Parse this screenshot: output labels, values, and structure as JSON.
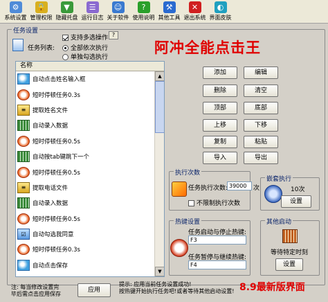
{
  "toolbar": {
    "items": [
      {
        "label": "系统设置",
        "icon": "gear-icon",
        "color": "#4f8bd8",
        "glyph": "⚙"
      },
      {
        "label": "管理权限",
        "icon": "lock-icon",
        "color": "#d8b020",
        "glyph": "🔒"
      },
      {
        "label": "隐藏托盘",
        "icon": "hide-tray-icon",
        "color": "#3a9a3a",
        "glyph": "▼"
      },
      {
        "label": "运行日志",
        "icon": "log-icon",
        "color": "#8a6ad0",
        "glyph": "☰"
      },
      {
        "label": "关于软件",
        "icon": "people-icon",
        "color": "#3a7ad0",
        "glyph": "☺"
      },
      {
        "label": "使用说明",
        "icon": "help-icon",
        "color": "#2aa02a",
        "glyph": "?"
      },
      {
        "label": "其他工具",
        "icon": "tools-icon",
        "color": "#2a6ad0",
        "glyph": "⚒"
      },
      {
        "label": "退出系统",
        "icon": "exit-icon",
        "color": "#d02020",
        "glyph": "✕"
      },
      {
        "label": "界面皮肤",
        "icon": "skin-icon",
        "color": "#20a0c0",
        "glyph": "◐"
      }
    ]
  },
  "task_settings": {
    "legend": "任务设置",
    "big_title": "阿冲全能点击王",
    "multi_select_label": "支持多选操作",
    "help_button": "?",
    "task_list_label": "任务列表:",
    "radio_all": "全部依次执行",
    "radio_single": "单独勾选执行",
    "list_header": "名称",
    "list_items": [
      {
        "text": "自动点击姓名输入框",
        "icon": "mouse-icon",
        "kind": "mouse",
        "glyph": ""
      },
      {
        "text": "短时停顿任务0.3s",
        "icon": "clock-icon",
        "kind": "clock",
        "glyph": ""
      },
      {
        "text": "提取姓名文件",
        "icon": "file-icon",
        "kind": "file",
        "glyph": "≡"
      },
      {
        "text": "自动录入数据",
        "icon": "keyboard-icon",
        "kind": "kbd",
        "glyph": ""
      },
      {
        "text": "短时停顿任务0.5s",
        "icon": "clock-icon",
        "kind": "clock",
        "glyph": ""
      },
      {
        "text": "自动按tab键跳下一个",
        "icon": "keyboard-icon",
        "kind": "kbd",
        "glyph": ""
      },
      {
        "text": "短时停顿任务0.5s",
        "icon": "clock-icon",
        "kind": "clock",
        "glyph": ""
      },
      {
        "text": "提取电话文件",
        "icon": "file-icon",
        "kind": "file",
        "glyph": "≡"
      },
      {
        "text": "自动录入数据",
        "icon": "keyboard-icon",
        "kind": "kbd",
        "glyph": ""
      },
      {
        "text": "短时停顿任务0.5s",
        "icon": "clock-icon",
        "kind": "clock",
        "glyph": ""
      },
      {
        "text": "自动勾选我同意",
        "icon": "select-icon",
        "kind": "sel",
        "glyph": "☑"
      },
      {
        "text": "短时停顿任务0.3s",
        "icon": "clock-icon",
        "kind": "clock",
        "glyph": ""
      },
      {
        "text": "自动点击保存",
        "icon": "mouse-icon",
        "kind": "mouse",
        "glyph": ""
      }
    ],
    "buttons": {
      "add": "添加",
      "edit": "编辑",
      "delete": "删除",
      "clear": "清空",
      "top": "顶部",
      "bottom": "底部",
      "up": "上移",
      "down": "下移",
      "copy": "复制",
      "paste": "粘贴",
      "import": "导入",
      "export": "导出"
    }
  },
  "exec_count": {
    "legend": "执行次数",
    "label": "任务执行次数:",
    "value": "39000",
    "unit": "次",
    "unlimited_label": "不限制执行次数"
  },
  "nest_exec": {
    "legend": "嵌套执行",
    "count": "10次",
    "settings_button": "设置"
  },
  "hotkey": {
    "legend": "热键设置",
    "start_stop_label": "任务启动与停止热键:",
    "start_stop_value": "F3",
    "pause_label": "任务暂停与继续热键:",
    "pause_value": "F4"
  },
  "other_start": {
    "legend": "其他启动",
    "wait_label": "等待特定时刻",
    "settings_button": "设置"
  },
  "footer": {
    "note_line1": "注: 每当修改设置完",
    "note_line2": "毕后需点击应用保存",
    "apply_button": "应用",
    "tip_line1": "提示: 应用当前任务设置成功!",
    "tip_line2": "按热键开始执行任务吧!或者等待其他启动设置!",
    "version": "8.9最新版界面"
  }
}
